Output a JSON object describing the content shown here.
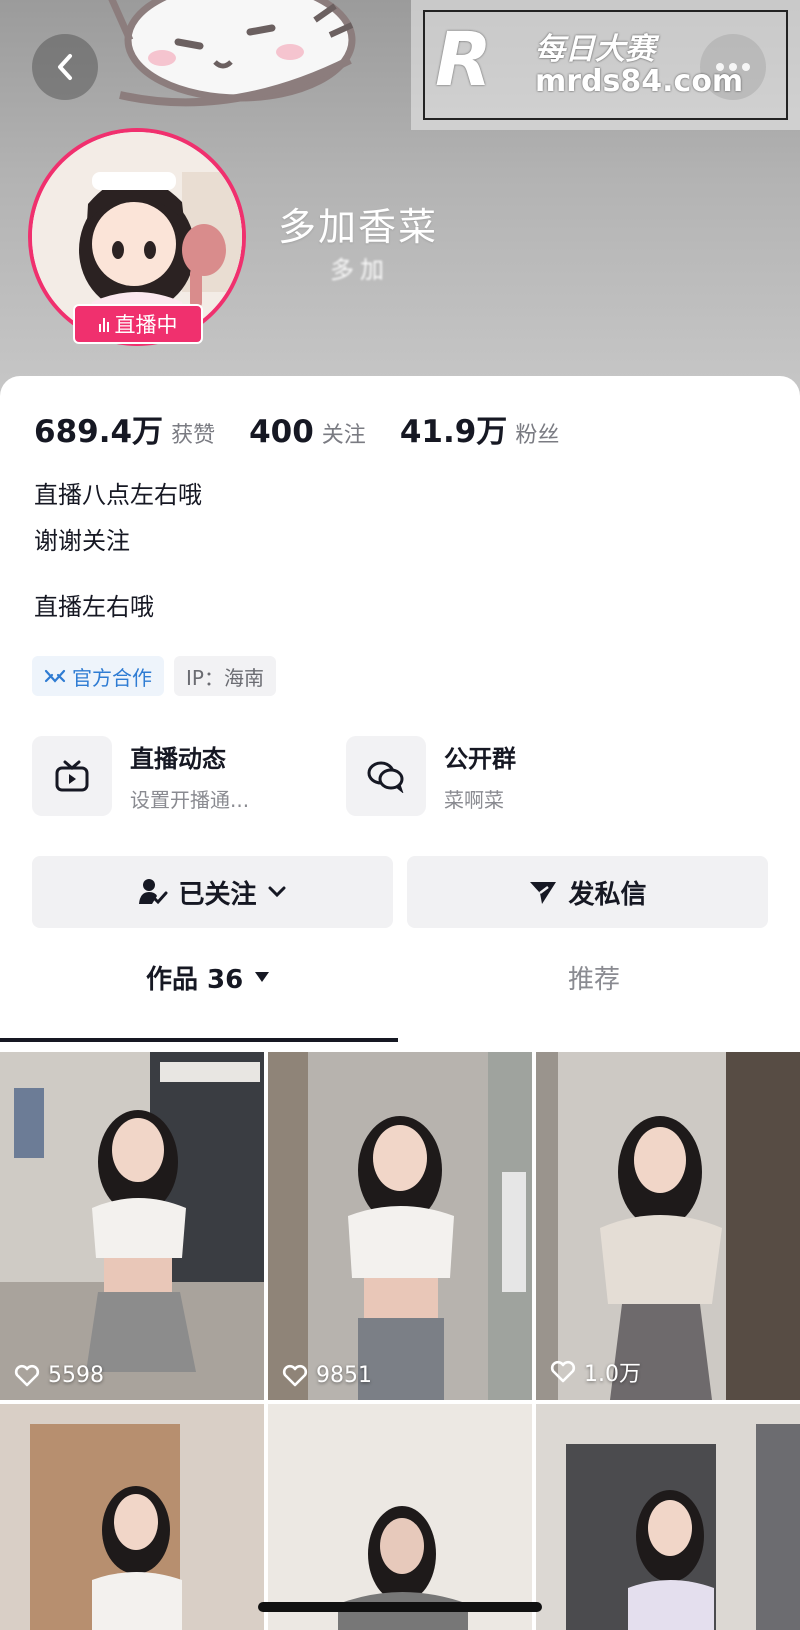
{
  "header": {
    "nickname": "多加香菜",
    "subname": "多加",
    "live_badge": "直播中",
    "watermark": {
      "logo_letter": "R",
      "title": "每日大赛",
      "url": "mrds84.com"
    }
  },
  "stats": [
    {
      "value": "689.4万",
      "label": "获赞"
    },
    {
      "value": "400",
      "label": "关注"
    },
    {
      "value": "41.9万",
      "label": "粉丝"
    }
  ],
  "bio": {
    "line1": "直播八点左右哦",
    "line2": "谢谢关注",
    "line3": "直播左右哦"
  },
  "tags": {
    "official": "官方合作",
    "ip": "IP：海南"
  },
  "features": {
    "live": {
      "title": "直播动态",
      "subtitle": "设置开播通..."
    },
    "group": {
      "title": "公开群",
      "subtitle": "菜啊菜"
    }
  },
  "buttons": {
    "follow": "已关注",
    "message": "发私信"
  },
  "tabs": {
    "works": "作品 36",
    "recommend": "推荐"
  },
  "videos": [
    {
      "likes": "5598"
    },
    {
      "likes": "9851"
    },
    {
      "likes": "1.0万"
    },
    {
      "likes": ""
    },
    {
      "likes": ""
    },
    {
      "likes": ""
    }
  ],
  "colors": {
    "live_pink": "#f0306e",
    "official_blue": "#2f7cd3",
    "text_primary": "#161823",
    "text_secondary": "#7a7b82"
  }
}
